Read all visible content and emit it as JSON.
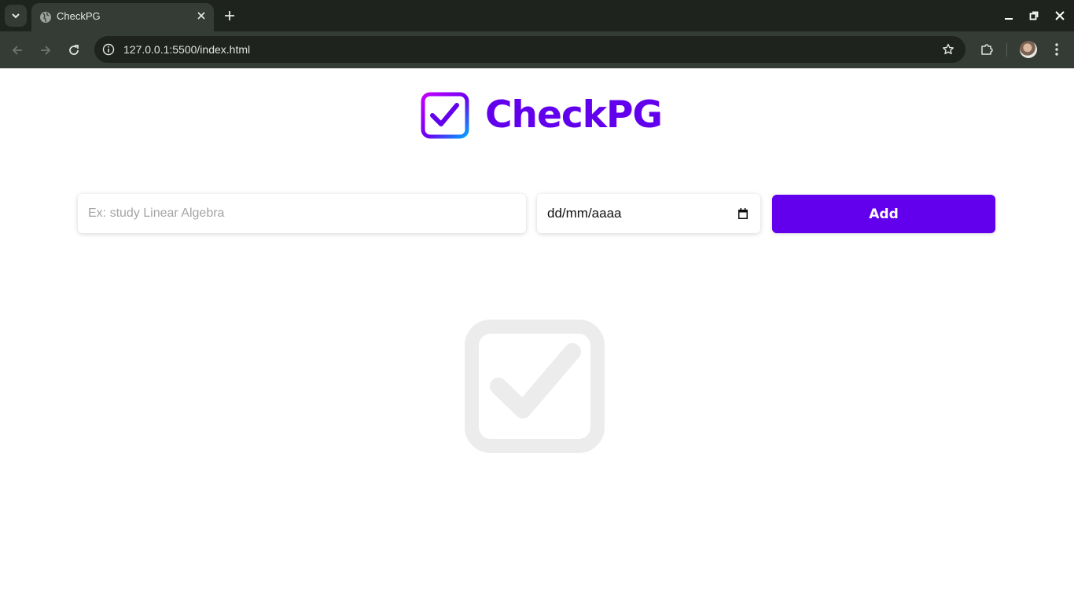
{
  "browser": {
    "tab_title": "CheckPG",
    "url": "127.0.0.1:5500/index.html"
  },
  "app": {
    "name": "CheckPG",
    "brand_color": "#6200ee"
  },
  "form": {
    "task_placeholder": "Ex: study Linear Algebra",
    "date_value": "dd/mm/aaaa",
    "add_label": "Add"
  },
  "icons": {
    "logo": "checkbox-icon",
    "empty_state": "checkbox-icon"
  }
}
